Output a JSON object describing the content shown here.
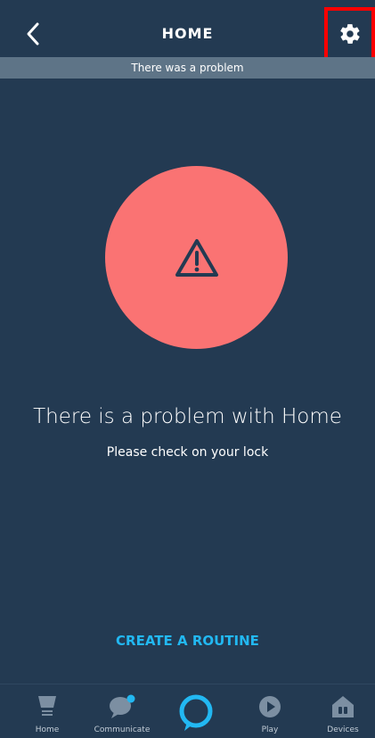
{
  "header": {
    "title": "HOME"
  },
  "banner": {
    "text": "There was a problem"
  },
  "main": {
    "headline": "There is a problem with Home",
    "subtext": "Please check on your lock",
    "routine_link": "CREATE A ROUTINE"
  },
  "icons": {
    "back": "chevron-left-icon",
    "settings": "gear-icon",
    "alert": "warning-icon"
  },
  "colors": {
    "background": "#233a52",
    "banner": "#5e7487",
    "alert_circle": "#fa7373",
    "link": "#22b8f2",
    "highlight": "#ff0000"
  },
  "bottom_nav": {
    "items": [
      {
        "label": "Home",
        "icon": "home-icon"
      },
      {
        "label": "Communicate",
        "icon": "chat-icon"
      },
      {
        "label": "",
        "icon": "alexa-icon"
      },
      {
        "label": "Play",
        "icon": "play-icon"
      },
      {
        "label": "Devices",
        "icon": "devices-icon"
      }
    ]
  }
}
